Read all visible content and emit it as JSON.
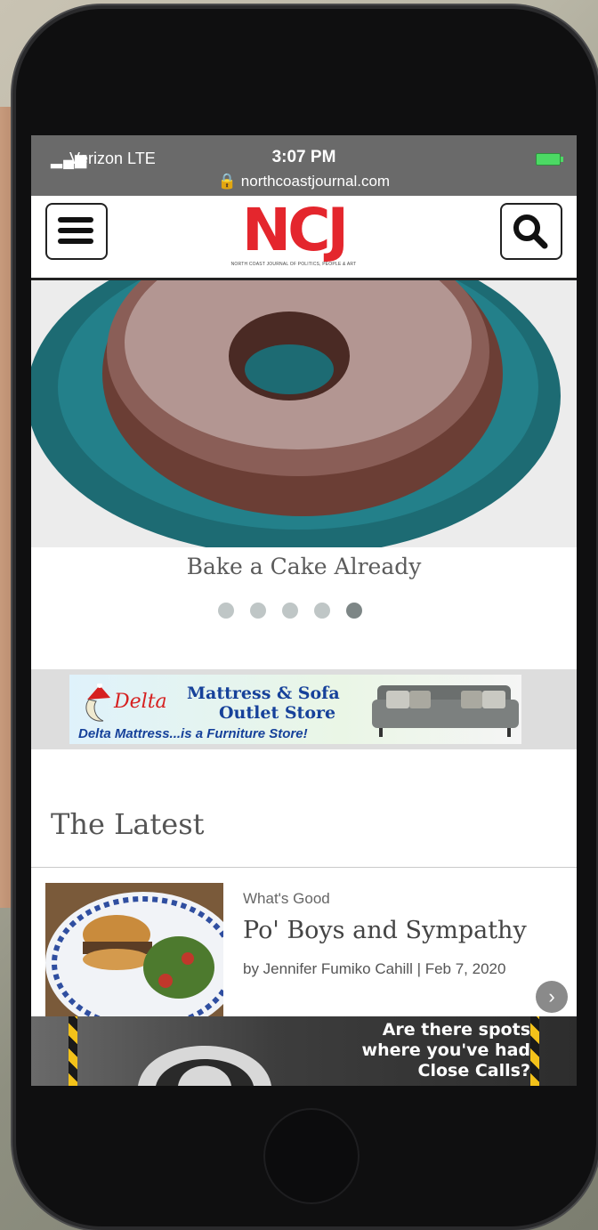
{
  "status_bar": {
    "signal": "▂▄▆",
    "carrier": "Verizon  LTE",
    "time": "3:07 PM",
    "url": "🔒 northcoastjournal.com"
  },
  "header": {
    "logo_text": "NCJ",
    "tagline": "NORTH COAST JOURNAL OF POLITICS, PEOPLE & ART"
  },
  "hero": {
    "caption": "Bake a Cake Already",
    "slide_count": 5,
    "active_slide": 5
  },
  "ad_banner": {
    "brand": "Delta",
    "title_line1": "Mattress & Sofa",
    "title_line2": "Outlet Store",
    "slogan": "Delta Mattress...is a Furniture Store!"
  },
  "latest": {
    "heading": "The Latest",
    "articles": [
      {
        "category": "What's Good",
        "title": "Po' Boys and Sympathy",
        "byline": "by Jennifer Fumiko Cahill | Feb 7, 2020"
      }
    ]
  },
  "bottom_ad": {
    "line1": "Are there spots",
    "line2": "where you've had",
    "line3": "Close Calls?"
  },
  "colors": {
    "logo_red": "#e4262d",
    "ad_blue": "#16419a",
    "status_bar_gray": "#6a6a6a"
  }
}
